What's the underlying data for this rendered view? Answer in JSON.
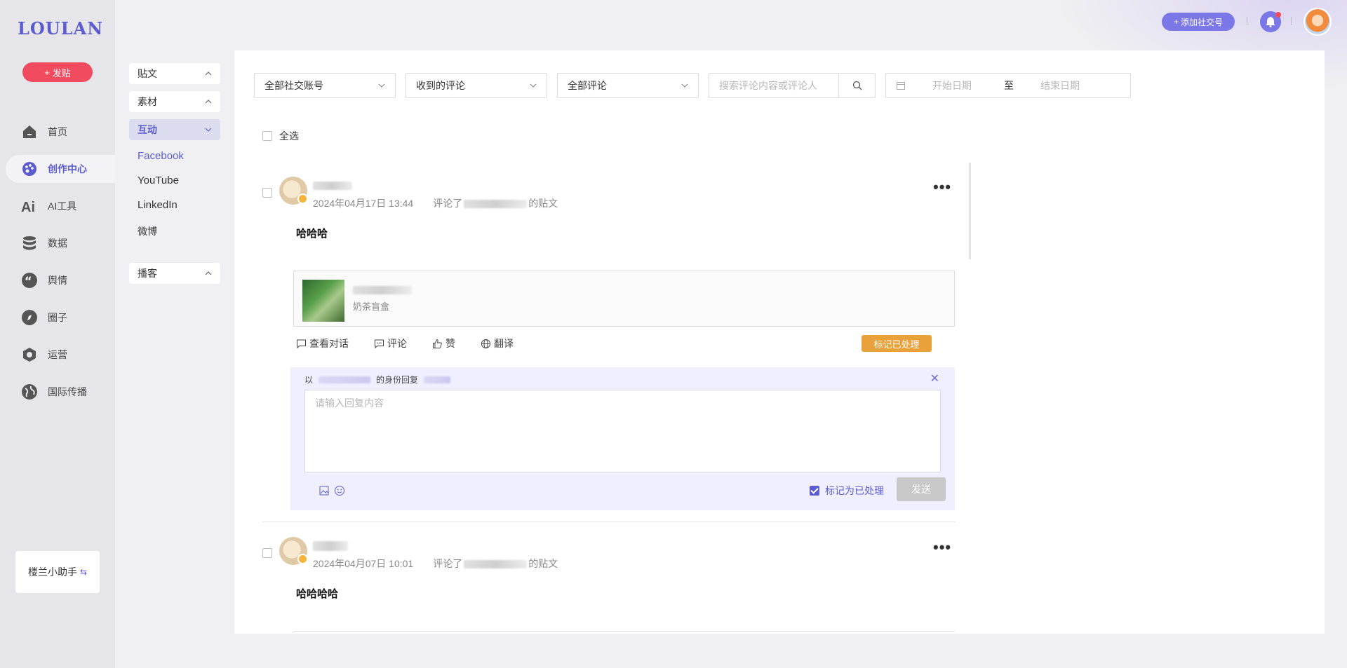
{
  "brand": {
    "logo": "LOULAN",
    "post_button": "发贴"
  },
  "nav": {
    "items": [
      {
        "label": "首页",
        "icon": "home-icon"
      },
      {
        "label": "创作中心",
        "icon": "palette-icon"
      },
      {
        "label": "AI工具",
        "icon": "ai-icon"
      },
      {
        "label": "数据",
        "icon": "database-icon"
      },
      {
        "label": "舆情",
        "icon": "quote-icon"
      },
      {
        "label": "圈子",
        "icon": "compass-icon"
      },
      {
        "label": "运营",
        "icon": "operations-icon"
      },
      {
        "label": "国际传播",
        "icon": "globe-icon"
      }
    ],
    "active": "创作中心",
    "helper": "楼兰小助手"
  },
  "subnav": {
    "groups": [
      "贴文",
      "素材",
      "互动",
      "播客"
    ],
    "active_group": "互动",
    "links": [
      "Facebook",
      "YouTube",
      "LinkedIn",
      "微博"
    ],
    "active_link": "Facebook"
  },
  "header": {
    "add_social": "添加社交号"
  },
  "filters": {
    "account": "全部社交账号",
    "comment_type": "收到的评论",
    "comment_scope": "全部评论",
    "search_placeholder": "搜索评论内容或评论人",
    "start_date": "开始日期",
    "to": "至",
    "end_date": "结束日期"
  },
  "select_all": "全选",
  "comments": [
    {
      "time": "2024年04月17日 13:44",
      "commented_prefix": "评论了",
      "commented_suffix": "的贴文",
      "text": "哈哈哈",
      "post_sub": "奶茶盲盒",
      "actions": [
        "查看对话",
        "评论",
        "赞",
        "翻译"
      ],
      "mark_button": "标记已处理",
      "reply": {
        "as_prefix": "以",
        "as_suffix": "的身份回复",
        "placeholder": "请输入回复内容",
        "mark_label": "标记为已处理",
        "send": "发送"
      }
    },
    {
      "time": "2024年04月07日 10:01",
      "commented_prefix": "评论了",
      "commented_suffix": "的贴文",
      "text": "哈哈哈哈"
    }
  ],
  "colors": {
    "accent": "#5c5ccf",
    "post_button": "#f04b5f",
    "mark_button": "#e9a23b"
  }
}
